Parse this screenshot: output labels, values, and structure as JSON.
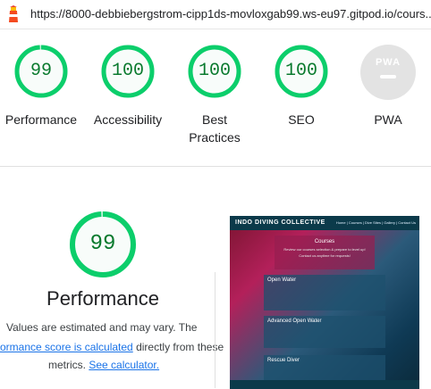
{
  "url": "https://8000-debbiebergstrom-cipp1ds-movloxgab99.ws-eu97.gitpod.io/cours...",
  "colors": {
    "pass": "#0cce6b",
    "pass_text": "#0a7a2e",
    "pass_fill": "#e6f7ed",
    "link": "#1a73e8"
  },
  "icons": {
    "logo": "lighthouse-icon",
    "pwa": "pwa-badge-icon"
  },
  "categories": [
    {
      "label": "Performance",
      "score": "99",
      "value": 0.99
    },
    {
      "label": "Accessibility",
      "score": "100",
      "value": 1.0
    },
    {
      "label": "Best Practices",
      "label_line1": "Best",
      "label_line2": "Practices",
      "score": "100",
      "value": 1.0
    },
    {
      "label": "SEO",
      "score": "100",
      "value": 1.0
    },
    {
      "label": "PWA",
      "badge": "PWA"
    }
  ],
  "performance": {
    "score": "99",
    "title": "Performance",
    "note_1": "Values are estimated and may vary. The",
    "note_link": "ormance score is calculated",
    "note_2": "directly from these",
    "note_3": "metrics.",
    "calculator_link": "See calculator."
  },
  "screenshot": {
    "brand": "INDO DIVING COLLECTIVE",
    "menu": "Home | Courses | Dive Sites | Gallery | Contact Us",
    "hero_title": "Courses",
    "hero_text": "Review our courses selection & prepare to level up!",
    "hero_cta": "Contact us anytime for requests!",
    "card_1": "Open Water",
    "card_2": "Advanced Open Water",
    "card_3": "Rescue Diver"
  }
}
